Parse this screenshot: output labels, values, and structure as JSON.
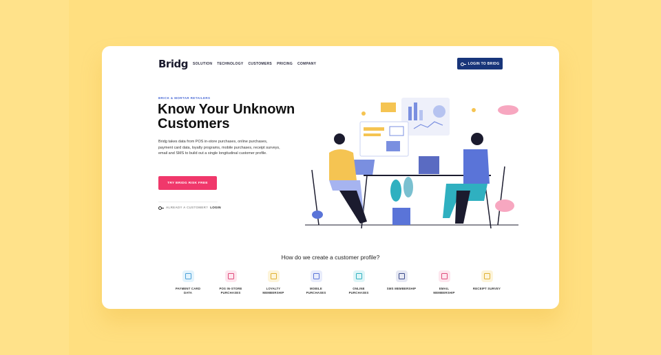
{
  "brand": {
    "logo_text": "Bridg",
    "primary_color": "#18357a",
    "accent_color": "#f0386b"
  },
  "nav": {
    "links": [
      "SOLUTION",
      "TECHNOLOGY",
      "CUSTOMERS",
      "PRICING",
      "COMPANY"
    ],
    "login_label": "LOGIN TO BRIDG"
  },
  "hero": {
    "eyebrow": "BRICK & MORTAR RETAILERS",
    "headline": "Know Your Unknown Customers",
    "description": "Bridg takes data from POS in-store purchases, online purchases, payment card data, loyalty programs, mobile purchases, receipt surveys, email and SMS to build out a single longitudinal customer profile.",
    "cta_label": "TRY BRIDG RISK FREE",
    "already_text": "ALREADY A CUSTOMER?",
    "login_link": "LOGIN"
  },
  "profile_section": {
    "question": "How do we create a customer profile?",
    "features": [
      {
        "label": "PAYMENT CARD DATA",
        "icon": "card-icon",
        "color": "#4aa0d8",
        "bg": "#e3f3fc"
      },
      {
        "label": "POS IN-STORE PURCHASES",
        "icon": "pos-icon",
        "color": "#e04a7a",
        "bg": "#fde6ee"
      },
      {
        "label": "LOYALTY MEMBERSHIP",
        "icon": "loyalty-icon",
        "color": "#e0b030",
        "bg": "#fdf4d9"
      },
      {
        "label": "MOBILE PURCHASES",
        "icon": "mobile-icon",
        "color": "#5a74d8",
        "bg": "#e8ecfb"
      },
      {
        "label": "ONLINE PURCHASES",
        "icon": "online-icon",
        "color": "#2fb0c0",
        "bg": "#def5f7"
      },
      {
        "label": "SMS MEMBERSHIP",
        "icon": "sms-icon",
        "color": "#3a4a8a",
        "bg": "#e6e8f3"
      },
      {
        "label": "EMAIL MEMBERSHIP",
        "icon": "email-icon",
        "color": "#e04a7a",
        "bg": "#fde6ee"
      },
      {
        "label": "RECEIPT SURVEY",
        "icon": "receipt-icon",
        "color": "#e0b030",
        "bg": "#fdf4d9"
      }
    ]
  }
}
